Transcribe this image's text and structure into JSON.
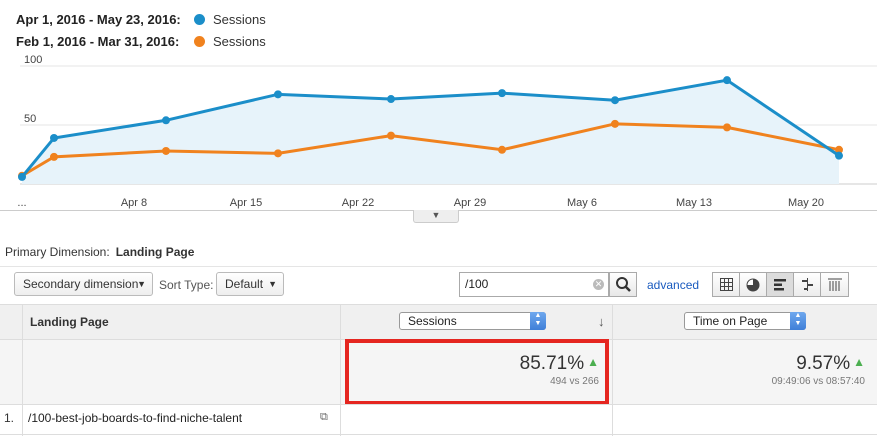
{
  "legend": {
    "current": {
      "range": "Apr 1, 2016 - May 23, 2016:",
      "metric": "Sessions",
      "color": "#1b8ec9"
    },
    "previous": {
      "range": "Feb 1, 2016 - Mar 31, 2016:",
      "metric": "Sessions",
      "color": "#f0821e"
    }
  },
  "chart_data": {
    "type": "line",
    "x_ticks": [
      "...",
      "Apr 8",
      "Apr 15",
      "Apr 22",
      "Apr 29",
      "May 6",
      "May 13",
      "May 20"
    ],
    "y_ticks": [
      "100",
      "50"
    ],
    "ylim": [
      0,
      100
    ],
    "grid": true,
    "series": [
      {
        "name": "Apr 1, 2016 - May 23, 2016",
        "color": "#1b8ec9",
        "area": true,
        "x": [
          "Apr 1",
          "Apr 2",
          "Apr 9",
          "Apr 16",
          "Apr 23",
          "Apr 30",
          "May 7",
          "May 14",
          "May 23"
        ],
        "values": [
          6,
          39,
          54,
          76,
          72,
          77,
          71,
          88,
          24
        ]
      },
      {
        "name": "Feb 1, 2016 - Mar 31, 2016",
        "color": "#f0821e",
        "area": false,
        "x": [
          "Apr 1",
          "Apr 2",
          "Apr 9",
          "Apr 16",
          "Apr 23",
          "Apr 30",
          "May 7",
          "May 14",
          "May 23"
        ],
        "values": [
          7,
          23,
          28,
          26,
          41,
          29,
          51,
          48,
          29
        ]
      }
    ]
  },
  "primary_dimension": {
    "label": "Primary Dimension:",
    "value": "Landing Page"
  },
  "toolbar": {
    "secondary_dimension": "Secondary dimension",
    "sort_type_label": "Sort Type:",
    "sort_type_value": "Default",
    "search_value": "/100",
    "advanced": "advanced"
  },
  "table": {
    "col_landing": "Landing Page",
    "col_metric1": "Sessions",
    "col_metric2": "Time on Page",
    "summary": {
      "sessions_change": "85.71%",
      "sessions_vs": "494 vs 266",
      "time_change": "9.57%",
      "time_vs": "09:49:06 vs 08:57:40"
    },
    "rows": [
      {
        "num": "1.",
        "page": "/100-best-job-boards-to-find-niche-talent"
      }
    ]
  }
}
